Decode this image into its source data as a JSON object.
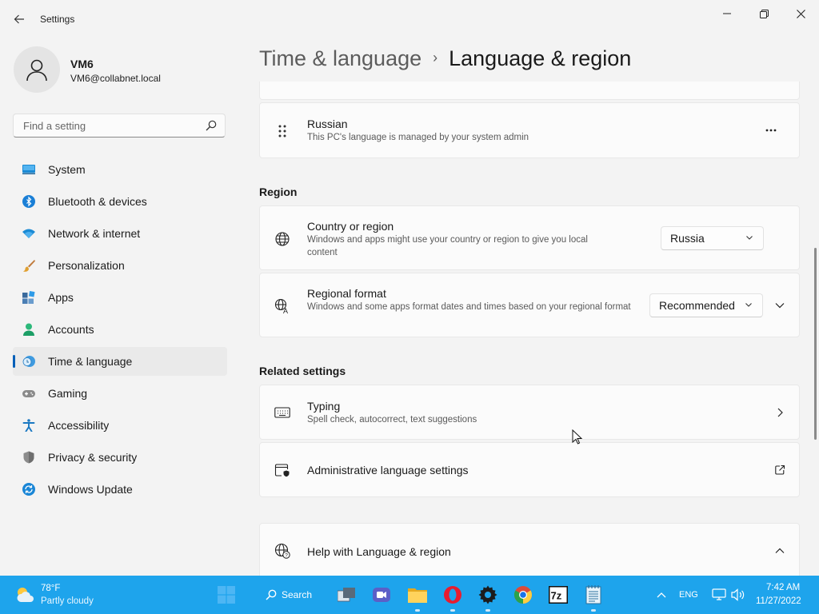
{
  "window": {
    "title": "Settings",
    "back_icon": "back-arrow-icon",
    "controls": [
      "minimize",
      "maximize",
      "close"
    ]
  },
  "profile": {
    "name": "VM6",
    "email": "VM6@collabnet.local",
    "avatar_icon": "person-icon"
  },
  "search": {
    "placeholder": "Find a setting",
    "value": ""
  },
  "nav": {
    "items": [
      {
        "label": "System",
        "icon": "system-display-icon",
        "active": false
      },
      {
        "label": "Bluetooth & devices",
        "icon": "bluetooth-icon",
        "active": false
      },
      {
        "label": "Network & internet",
        "icon": "wifi-icon",
        "active": false
      },
      {
        "label": "Personalization",
        "icon": "paintbrush-icon",
        "active": false
      },
      {
        "label": "Apps",
        "icon": "apps-icon",
        "active": false
      },
      {
        "label": "Accounts",
        "icon": "accounts-icon",
        "active": false
      },
      {
        "label": "Time & language",
        "icon": "time-language-icon",
        "active": true
      },
      {
        "label": "Gaming",
        "icon": "gamepad-icon",
        "active": false
      },
      {
        "label": "Accessibility",
        "icon": "accessibility-icon",
        "active": false
      },
      {
        "label": "Privacy & security",
        "icon": "shield-icon",
        "active": false
      },
      {
        "label": "Windows Update",
        "icon": "windows-update-icon",
        "active": false
      }
    ]
  },
  "header": {
    "parent": "Time & language",
    "separator": "›",
    "current": "Language & region"
  },
  "language_card": {
    "title": "Russian",
    "desc": "This PC's language is managed by your system admin",
    "more": "..."
  },
  "region": {
    "section_title": "Region",
    "country": {
      "title": "Country or region",
      "desc": "Windows and apps might use your country or region to give you local content",
      "value": "Russia"
    },
    "format": {
      "title": "Regional format",
      "desc": "Windows and some apps format dates and times based on your regional format",
      "value": "Recommended"
    }
  },
  "related": {
    "section_title": "Related settings",
    "typing": {
      "title": "Typing",
      "desc": "Spell check, autocorrect, text suggestions"
    },
    "admin": {
      "title": "Administrative language settings"
    }
  },
  "help": {
    "title": "Help with Language & region"
  },
  "taskbar": {
    "weather_temp": "78°F",
    "weather_desc": "Partly cloudy",
    "search_label": "Search",
    "apps": [
      "start",
      "task-view",
      "teams-meet",
      "file-explorer",
      "opera",
      "settings",
      "chrome",
      "7zip",
      "notepad"
    ],
    "language": "ENG",
    "time": "7:42 AM",
    "date": "11/27/2022"
  },
  "colors": {
    "accent": "#005fb8",
    "taskbar": "#1ea4ec",
    "background": "#f3f3f3",
    "card": "#fbfbfb"
  }
}
